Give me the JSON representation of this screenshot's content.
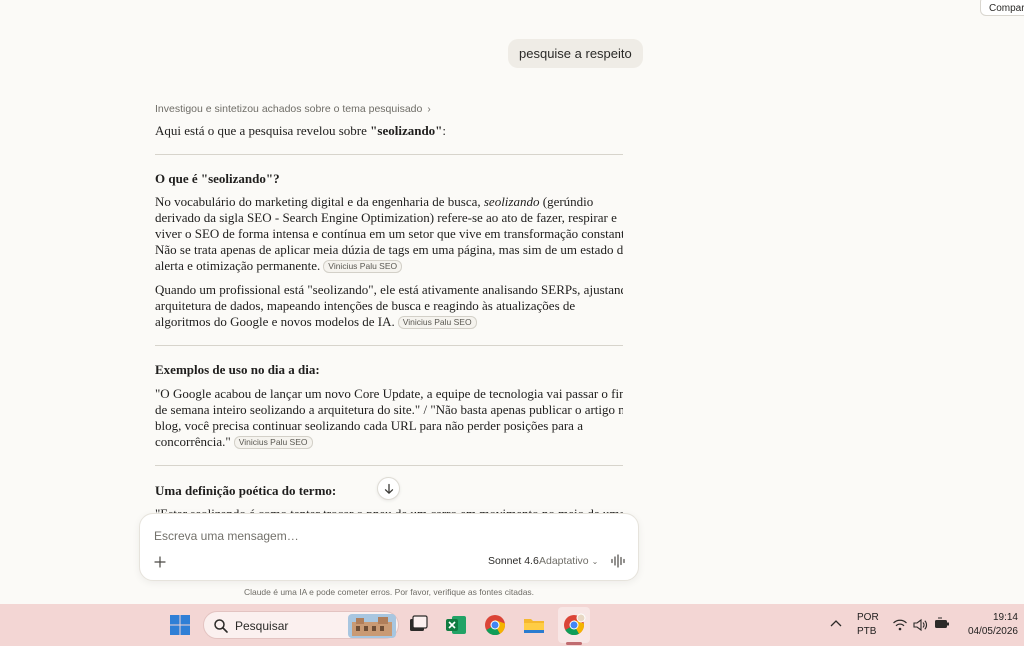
{
  "header": {
    "share_label": "Compartilhar"
  },
  "user_message": "pesquise a respeito",
  "response": {
    "process_label": "Investigou e sintetizou achados sobre o tema pesquisado",
    "intro_prefix": "Aqui está o que a pesquisa revelou sobre ",
    "intro_term": "\"seolizando\"",
    "intro_suffix": ":",
    "citation_label": "Vinicius Palu SEO",
    "section1": {
      "heading": "O que é \"seolizando\"?",
      "p1": {
        "line1_a": "No vocabulário do marketing digital e da engenharia de busca, ",
        "line1_em": "seolizando",
        "line1_b": " (gerúndio",
        "line2": "derivado da sigla SEO - Search Engine Optimization) refere-se ao ato de fazer, respirar e",
        "line3": "viver o SEO de forma intensa e contínua em um setor que vive em transformação constante.",
        "line4": "Não se trata apenas de aplicar meia dúzia de tags em uma página, mas sim de um estado de",
        "line5": "alerta e otimização permanente."
      },
      "p2": {
        "line1": "Quando um profissional está \"seolizando\", ele está ativamente analisando SERPs, ajustando",
        "line2": "arquitetura de dados, mapeando intenções de busca e reagindo às atualizações de",
        "line3": "algoritmos do Google e novos modelos de IA."
      }
    },
    "section2": {
      "heading": "Exemplos de uso no dia a dia:",
      "p1": {
        "line1": "\"O Google acabou de lançar um novo Core Update, a equipe de tecnologia vai passar o final",
        "line2": "de semana inteiro seolizando a arquitetura do site.\" / \"Não basta apenas publicar o artigo no",
        "line3": "blog, você precisa continuar seolizando cada URL para não perder posições para a",
        "line4": "concorrência.\""
      }
    },
    "section3": {
      "heading": "Uma definição poética do termo:",
      "partial_line": "\"Estar seolizando é como tentar trocar o pneu de um carro em movimento no meio de uma"
    }
  },
  "composer": {
    "placeholder": "Escreva uma mensagem…",
    "model": "Sonnet 4.6",
    "mode": "Adaptativo"
  },
  "disclaimer": "Claude é uma IA e pode cometer erros. Por favor, verifique as fontes citadas.",
  "taskbar": {
    "search_label": "Pesquisar",
    "lang_line1": "POR",
    "lang_line2": "PTB",
    "time": "19:14",
    "date": "04/05/2026"
  },
  "colors": {
    "background": "#fbfaf7",
    "taskbar": "#f3d6d4",
    "accent": "#c06c70"
  }
}
